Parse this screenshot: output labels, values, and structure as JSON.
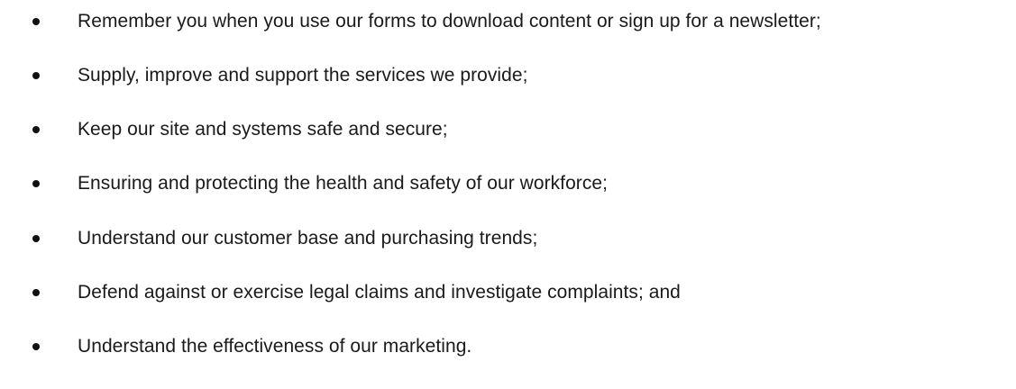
{
  "bullet_list": {
    "items": [
      "Remember you when you use our forms to download content or sign up for a newsletter;",
      "Supply, improve and support the services we provide;",
      "Keep our site and systems safe and secure;",
      "Ensuring and protecting the health and safety of our workforce;",
      "Understand our customer base and purchasing trends;",
      "Defend against or exercise legal claims and investigate complaints; and",
      "Understand the effectiveness of our marketing."
    ]
  }
}
